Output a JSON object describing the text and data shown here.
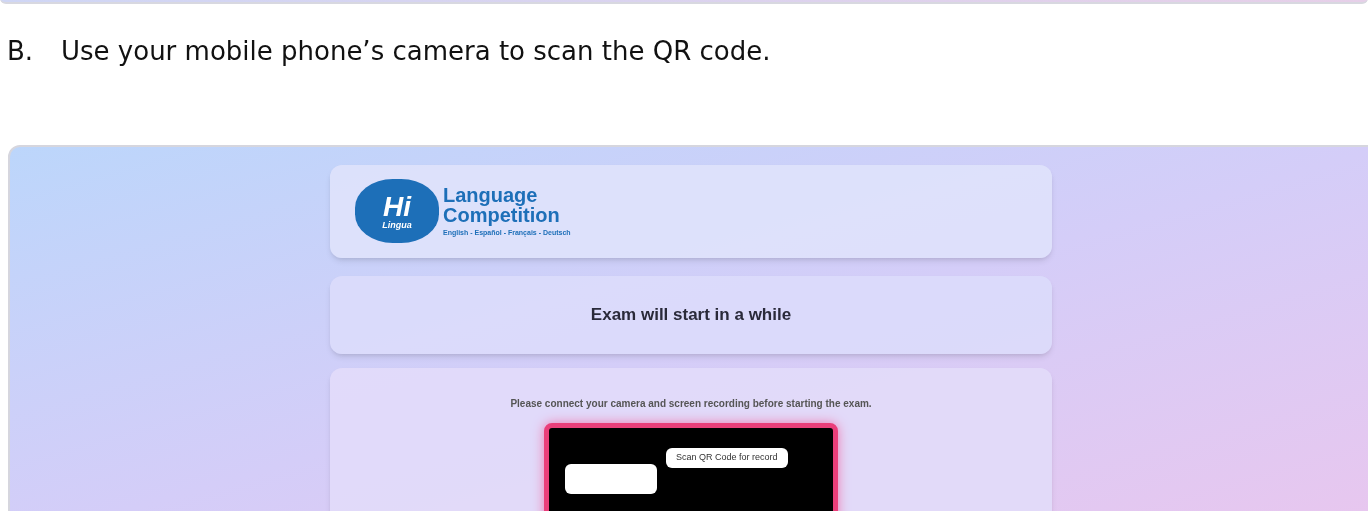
{
  "instruction": {
    "marker": "B.",
    "text": "Use your mobile phone’s camera to scan the QR code."
  },
  "screenshot": {
    "logo": {
      "mark": "Hi",
      "script": "Lingua",
      "title_lines": [
        "Language",
        "Competition"
      ],
      "tagline": "English - Español - Français - Deutsch"
    },
    "status": "Exam will start in a while",
    "setup": {
      "message": "Please connect your camera and screen recording before starting the exam.",
      "qr_label": "Scan QR Code for record"
    }
  }
}
